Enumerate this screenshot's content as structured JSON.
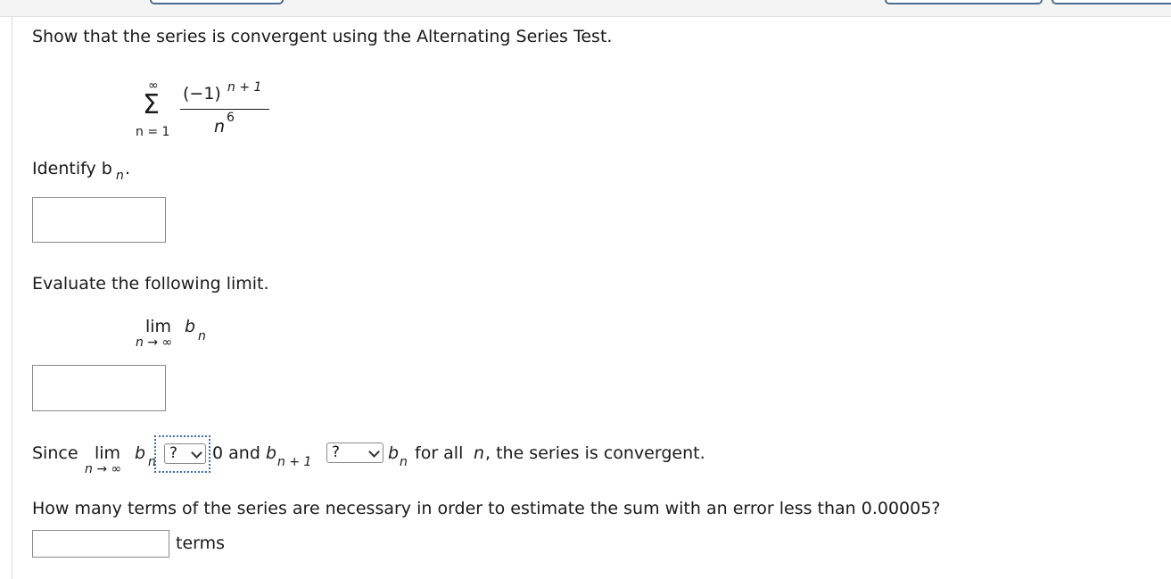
{
  "question": {
    "prompt": "Show that the series is convergent using the Alternating Series Test.",
    "series": {
      "sigma": "Σ",
      "upper": "∞",
      "lower": "n = 1",
      "numerator_base": "(−1)",
      "numerator_exp": "n + 1",
      "denominator_base": "n",
      "denominator_exp": "6"
    },
    "identify": {
      "label": "Identify b",
      "sub": "n",
      "period": "."
    },
    "bn_answer": "",
    "evaluate": {
      "label": "Evaluate the following limit.",
      "lim": "lim",
      "b": "b",
      "sub": "n",
      "under": "n → ∞"
    },
    "limit_answer": "",
    "since": {
      "since": "Since",
      "lim": "lim",
      "b": "b",
      "sub": "n",
      "under": "n → ∞",
      "select1": "?",
      "zero_and": "0 and",
      "b2": "b",
      "sub2": "n + 1",
      "select2": "?",
      "b3": "b",
      "sub3": "n",
      "for_all": "for all",
      "n": "n",
      "conclusion": ", the series is convergent."
    },
    "terms_question": "How many terms of the series are necessary in order to estimate the sum with an error less than 0.00005?",
    "terms_answer": "",
    "terms_label": "terms"
  }
}
